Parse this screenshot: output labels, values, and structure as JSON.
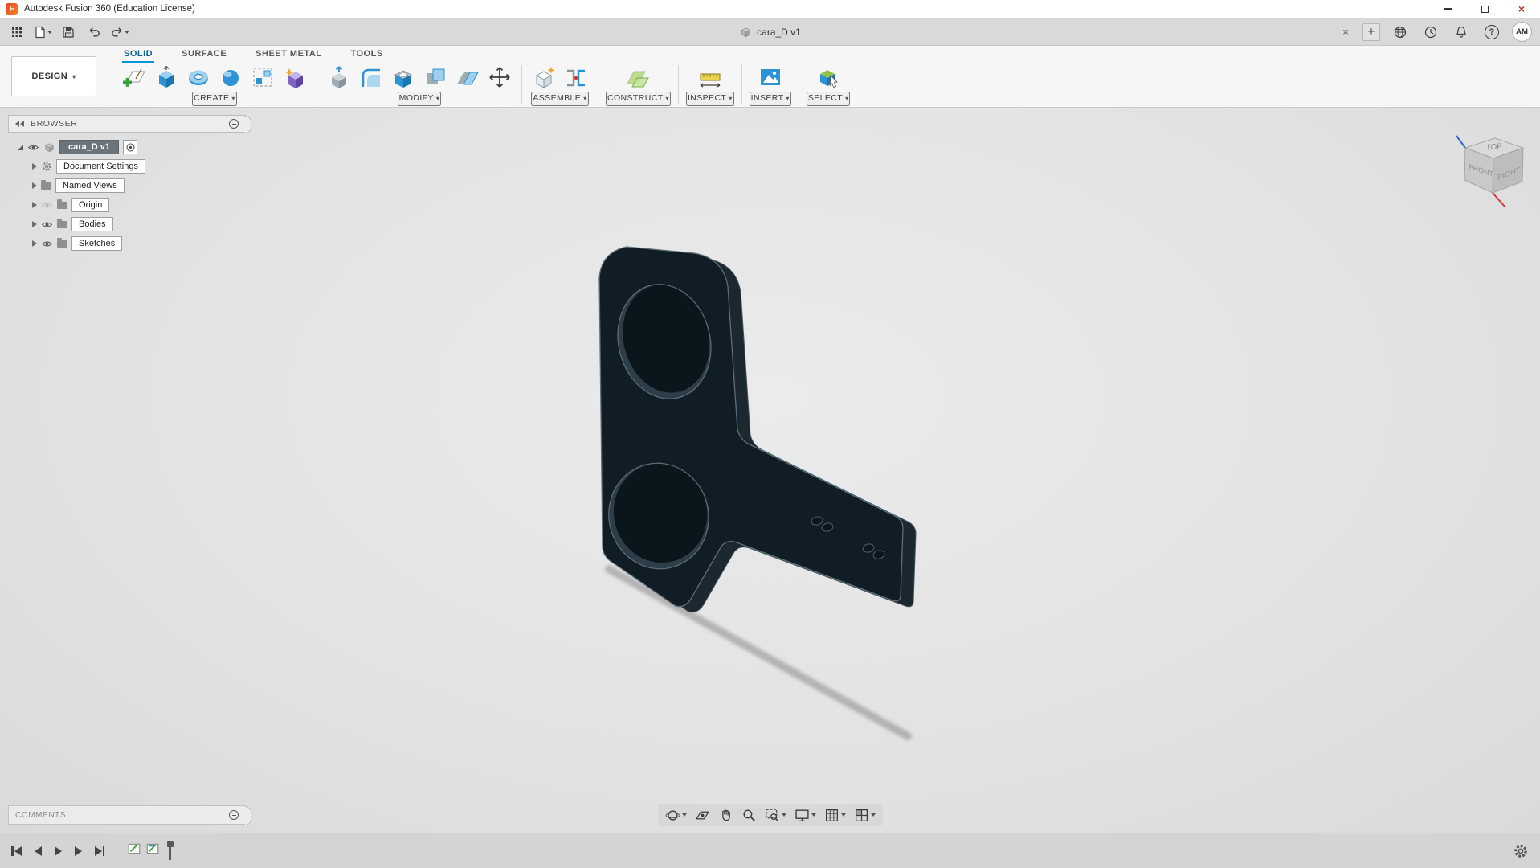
{
  "icons": {
    "close_x": "×",
    "plus": "+",
    "caret_down": "▾",
    "question": "?",
    "fusion_logo": "F"
  },
  "titlebar": {
    "title": "Autodesk Fusion 360 (Education License)"
  },
  "appbar": {
    "left_icons": [
      "grid-menu",
      "file",
      "save",
      "undo",
      "redo"
    ],
    "document_tab": {
      "label": "cara_D v1"
    },
    "right_icons": [
      "close-document-tab",
      "new-document-tab",
      "extensions-globe",
      "recent-clock",
      "notifications-bell",
      "help-question"
    ],
    "avatar": "AM"
  },
  "ribbon": {
    "workspace": "DESIGN",
    "tabs": [
      {
        "label": "SOLID",
        "active": true
      },
      {
        "label": "SURFACE",
        "active": false
      },
      {
        "label": "SHEET METAL",
        "active": false
      },
      {
        "label": "TOOLS",
        "active": false
      }
    ],
    "groups": [
      {
        "label": "CREATE",
        "icons": [
          "create-sketch",
          "extrude",
          "revolve",
          "sweep",
          "rectangular-pattern",
          "create-form"
        ]
      },
      {
        "label": "MODIFY",
        "icons": [
          "press-pull",
          "fillet",
          "shell",
          "combine",
          "offset-face",
          "move-copy"
        ]
      },
      {
        "label": "ASSEMBLE",
        "icons": [
          "new-component",
          "joint"
        ]
      },
      {
        "label": "CONSTRUCT",
        "icons": [
          "construction-plane"
        ]
      },
      {
        "label": "INSPECT",
        "icons": [
          "measure"
        ]
      },
      {
        "label": "INSERT",
        "icons": [
          "insert-image"
        ]
      },
      {
        "label": "SELECT",
        "icons": [
          "select-window"
        ]
      }
    ]
  },
  "browser": {
    "header": "BROWSER",
    "root": {
      "label": "cara_D v1"
    },
    "items": [
      {
        "label": "Document Settings",
        "icon": "gear",
        "visibility": "none"
      },
      {
        "label": "Named Views",
        "icon": "folder",
        "visibility": "none"
      },
      {
        "label": "Origin",
        "icon": "folder",
        "visibility": "hidden"
      },
      {
        "label": "Bodies",
        "icon": "folder",
        "visibility": "visible"
      },
      {
        "label": "Sketches",
        "icon": "folder",
        "visibility": "visible"
      }
    ]
  },
  "viewcube": {
    "top": "TOP",
    "front": "FRONT",
    "right": "RIGHT"
  },
  "comments": {
    "label": "COMMENTS"
  },
  "navbar": {
    "buttons": [
      "orbit",
      "look-at",
      "pan",
      "zoom",
      "fit",
      "display-settings",
      "grid-and-snaps",
      "viewports"
    ]
  },
  "timeline": {
    "controls": [
      "go-to-beginning",
      "step-back",
      "play",
      "step-forward",
      "go-to-end"
    ],
    "features": [
      "sketch-feature-1",
      "sketch-feature-2"
    ],
    "settings": "timeline-settings-gear"
  },
  "colors": {
    "accent": "#0696d7",
    "model_face": "#111d25",
    "model_edge": "#5d6e78",
    "canvas_bg": "#e5e5e5",
    "toolbar_bg": "#f6f6f6",
    "appbar_bg": "#d9d9d9"
  }
}
